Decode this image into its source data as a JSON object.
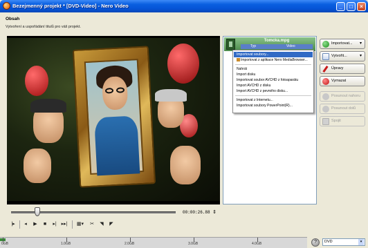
{
  "window": {
    "title": "Bezejmenný projekt * [DVD-Video] - Nero Video",
    "min": "_",
    "max": "□",
    "close": "×"
  },
  "section": {
    "heading": "Obsah",
    "subtitle": "Vytvoření a uspořádání titulů pro váš projekt."
  },
  "player": {
    "timecode": "00:00:26.88",
    "spin": "⇕",
    "controls": [
      "|▸",
      "◂",
      "▶",
      "■",
      "▸|",
      "▸▸|",
      "▦▾",
      "✂",
      "◥",
      "◤"
    ]
  },
  "media": {
    "filename": "Tomcka.mpg",
    "col_type": "Typ",
    "col_value": "Video"
  },
  "menu": {
    "items": [
      "Importovat soubory...",
      "Importovat z aplikace Nero MediaBrowser...",
      "Nahrát",
      "Import disku",
      "Importovat soubor AVCHD z fotoaparátu",
      "Import AVCHD z disku",
      "Import AVCHD z pevného disku...",
      "Importovat z Internetu...",
      "Importovat soubory PowerPoint(R)..."
    ]
  },
  "buttons": {
    "import": "Importovat...",
    "create": "Vytvořit...",
    "edit": "Úpravy",
    "delete": "Vymazat",
    "move_up": "Posunout nahoru",
    "move_down": "Posunout dolů",
    "merge": "Spojit",
    "caret": "▾"
  },
  "capacity": {
    "marks": [
      "0GB",
      "1.0GB",
      "2.0GB",
      "3.0GB",
      "4.0GB"
    ],
    "disc_type": "DVD",
    "help": "?"
  },
  "colors": {
    "titlebar": "#0554d6",
    "selection": "#316ac5",
    "media_item": "#4a8a4a"
  }
}
